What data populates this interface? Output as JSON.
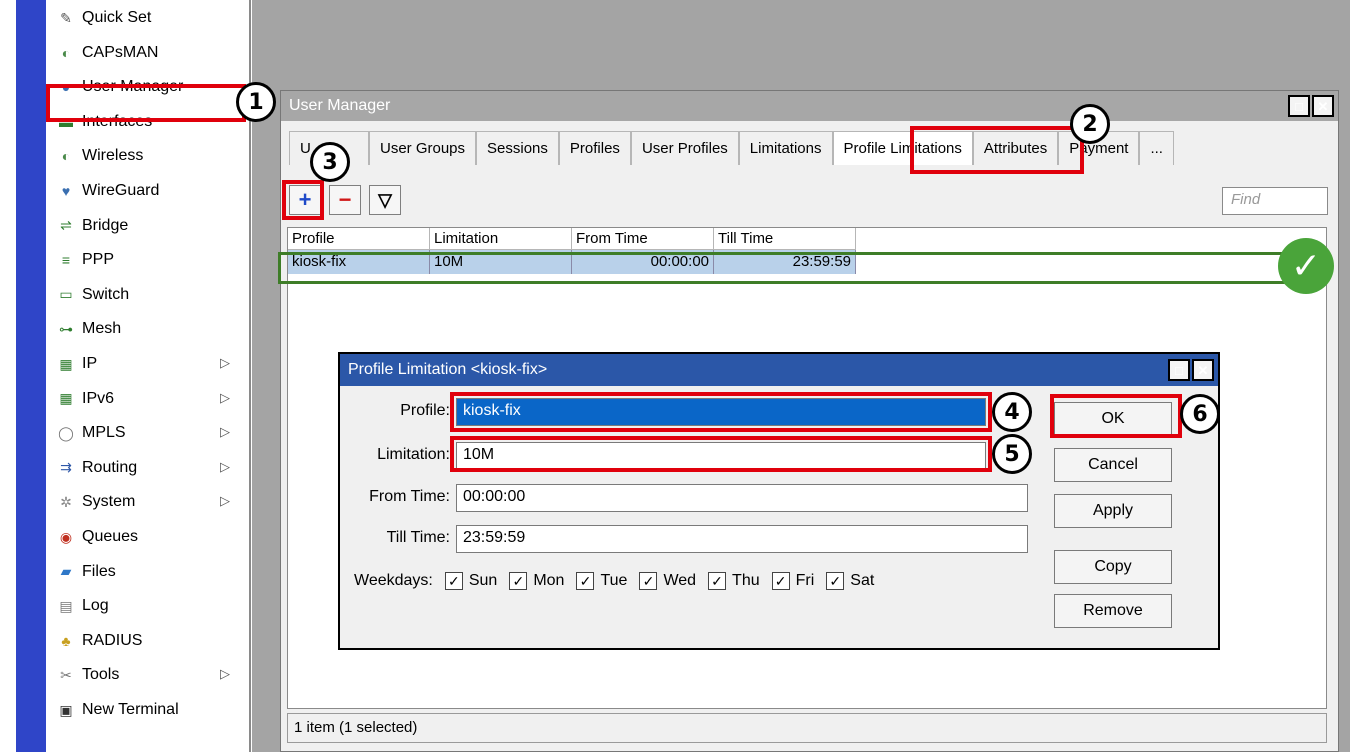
{
  "sidebar": {
    "items": [
      {
        "label": "Quick Set",
        "icon": "wand-icon",
        "glyph": "✎",
        "color": "#555555",
        "arrow": ""
      },
      {
        "label": "CAPsMAN",
        "icon": "antenna-icon",
        "glyph": "◐",
        "color": "#4a8a4a",
        "arrow": ""
      },
      {
        "label": "User Manager",
        "icon": "users-icon",
        "glyph": "●",
        "color": "#3a6fb0",
        "arrow": ""
      },
      {
        "label": "Interfaces",
        "icon": "interfaces-icon",
        "glyph": "▬",
        "color": "#2f7d2f",
        "arrow": ""
      },
      {
        "label": "Wireless",
        "icon": "wireless-icon",
        "glyph": "◐",
        "color": "#4a8a4a",
        "arrow": ""
      },
      {
        "label": "WireGuard",
        "icon": "wireguard-icon",
        "glyph": "♥",
        "color": "#3a6fb0",
        "arrow": ""
      },
      {
        "label": "Bridge",
        "icon": "bridge-icon",
        "glyph": "⇌",
        "color": "#2f7d2f",
        "arrow": ""
      },
      {
        "label": "PPP",
        "icon": "ppp-icon",
        "glyph": "≡",
        "color": "#2f7d2f",
        "arrow": ""
      },
      {
        "label": "Switch",
        "icon": "switch-icon",
        "glyph": "▭",
        "color": "#2f7d2f",
        "arrow": ""
      },
      {
        "label": "Mesh",
        "icon": "mesh-icon",
        "glyph": "⊶",
        "color": "#2f7d2f",
        "arrow": ""
      },
      {
        "label": "IP",
        "icon": "ip-icon",
        "glyph": "▦",
        "color": "#2f7d2f",
        "arrow": "▷"
      },
      {
        "label": "IPv6",
        "icon": "ipv6-icon",
        "glyph": "▦",
        "color": "#2f7d2f",
        "arrow": "▷"
      },
      {
        "label": "MPLS",
        "icon": "mpls-icon",
        "glyph": "◯",
        "color": "#777777",
        "arrow": "▷"
      },
      {
        "label": "Routing",
        "icon": "routing-icon",
        "glyph": "⇉",
        "color": "#2f58a8",
        "arrow": "▷"
      },
      {
        "label": "System",
        "icon": "system-gear-icon",
        "glyph": "✲",
        "color": "#888888",
        "arrow": "▷"
      },
      {
        "label": "Queues",
        "icon": "queues-icon",
        "glyph": "◉",
        "color": "#c03020",
        "arrow": ""
      },
      {
        "label": "Files",
        "icon": "folder-icon",
        "glyph": "▰",
        "color": "#2f78c8",
        "arrow": ""
      },
      {
        "label": "Log",
        "icon": "log-icon",
        "glyph": "▤",
        "color": "#777777",
        "arrow": ""
      },
      {
        "label": "RADIUS",
        "icon": "radius-icon",
        "glyph": "♣",
        "color": "#c8a020",
        "arrow": ""
      },
      {
        "label": "Tools",
        "icon": "tools-icon",
        "glyph": "✂",
        "color": "#777777",
        "arrow": "▷"
      },
      {
        "label": "New Terminal",
        "icon": "terminal-icon",
        "glyph": "▣",
        "color": "#333333",
        "arrow": ""
      }
    ]
  },
  "user_manager": {
    "title": "User Manager",
    "tabs": [
      "U",
      "User Groups",
      "Sessions",
      "Profiles",
      "User Profiles",
      "Limitations",
      "Profile Limitations",
      "Attributes",
      "Payment",
      "..."
    ],
    "active_tab": "Profile Limitations",
    "toolbar": {
      "add": "+",
      "remove": "−",
      "filter": "▽"
    },
    "find_placeholder": "Find",
    "columns": [
      "Profile",
      "Limitation",
      "From Time",
      "Till Time"
    ],
    "rows": [
      {
        "profile": "kiosk-fix",
        "limitation": "10M",
        "from_time": "00:00:00",
        "till_time": "23:59:59"
      }
    ],
    "status": "1 item (1 selected)"
  },
  "dialog": {
    "title": "Profile Limitation <kiosk-fix>",
    "fields": {
      "profile_label": "Profile:",
      "profile_value": "kiosk-fix",
      "limitation_label": "Limitation:",
      "limitation_value": "10M",
      "from_label": "From Time:",
      "from_value": "00:00:00",
      "till_label": "Till Time:",
      "till_value": "23:59:59"
    },
    "weekdays_label": "Weekdays:",
    "weekdays": [
      "Sun",
      "Mon",
      "Tue",
      "Wed",
      "Thu",
      "Fri",
      "Sat"
    ],
    "buttons": {
      "ok": "OK",
      "cancel": "Cancel",
      "apply": "Apply",
      "copy": "Copy",
      "remove": "Remove"
    }
  },
  "window_buttons": {
    "maximize": "□",
    "close": "✕"
  },
  "annotations": {
    "step1": "1",
    "step2": "2",
    "step3": "3",
    "step4": "4",
    "step5": "5",
    "step6": "6",
    "check": "✓"
  },
  "colors": {
    "highlight_red": "#e0000c",
    "confirm_green": "#4aa43a",
    "selected_row": "#b9d1ea",
    "dialog_title": "#2b57a8"
  }
}
